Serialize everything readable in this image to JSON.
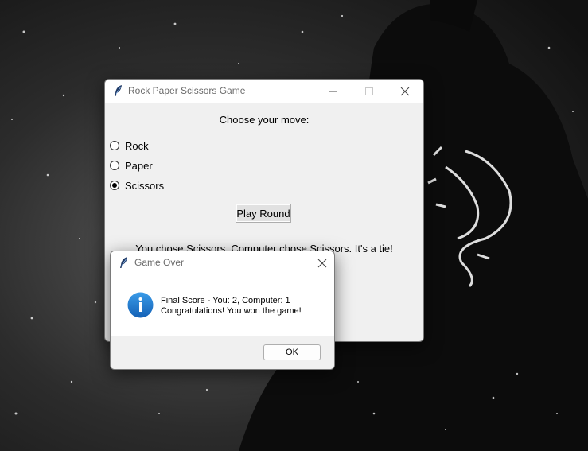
{
  "main_window": {
    "title": "Rock Paper Scissors Game",
    "prompt": "Choose your move:",
    "options": [
      {
        "label": "Rock",
        "checked": false
      },
      {
        "label": "Paper",
        "checked": false
      },
      {
        "label": "Scissors",
        "checked": true
      }
    ],
    "play_button": "Play Round",
    "result": "You chose Scissors. Computer chose Scissors. It's a tie!"
  },
  "dialog": {
    "title": "Game Over",
    "line1": "Final Score - You: 2, Computer: 1",
    "line2": "Congratulations! You won the game!",
    "ok_button": "OK",
    "icon": "info-icon"
  },
  "colors": {
    "info_blue": "#1a73c9",
    "window_bg": "#f0f0f0",
    "titlebar_text": "#6b6b6b"
  }
}
